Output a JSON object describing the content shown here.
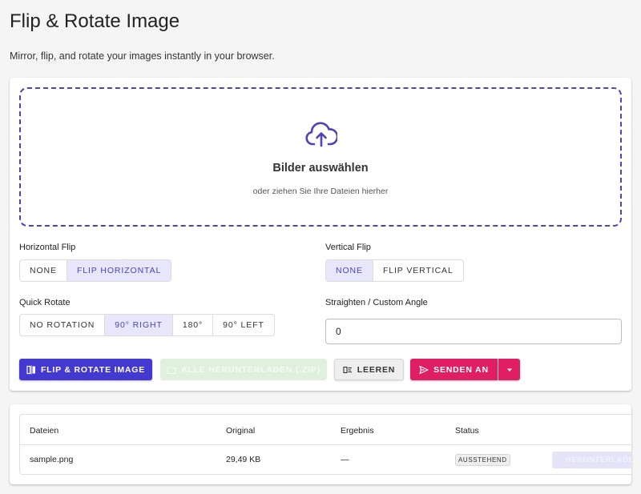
{
  "page": {
    "title": "Flip & Rotate Image",
    "subtitle": "Mirror, flip, and rotate your images instantly in your browser."
  },
  "dropzone": {
    "icon": "cloud-upload-icon",
    "title": "Bilder auswählen",
    "subtitle": "oder ziehen Sie Ihre Dateien hierher"
  },
  "horizontal_flip": {
    "label": "Horizontal Flip",
    "options": [
      "NONE",
      "FLIP HORIZONTAL"
    ],
    "selected": "FLIP HORIZONTAL"
  },
  "vertical_flip": {
    "label": "Vertical Flip",
    "options": [
      "NONE",
      "FLIP VERTICAL"
    ],
    "selected": "NONE"
  },
  "quick_rotate": {
    "label": "Quick Rotate",
    "options": [
      "NO ROTATION",
      "90° RIGHT",
      "180°",
      "90° LEFT"
    ],
    "selected": "90° RIGHT"
  },
  "custom_angle": {
    "label": "Straighten / Custom Angle",
    "value": "0"
  },
  "actions": {
    "process_label": "FLIP & ROTATE IMAGE",
    "download_all_label": "ALLE HERUNTERLADEN (.ZIP)",
    "clear_label": "LEEREN",
    "send_label": "SENDEN AN"
  },
  "colors": {
    "accent": "#4338d0",
    "send": "#e01e63",
    "dropzone_border": "#4c44b8"
  },
  "files_table": {
    "headers": [
      "Dateien",
      "Original",
      "Ergebnis",
      "Status"
    ],
    "rows": [
      {
        "name": "sample.png",
        "original": "29,49 KB",
        "result": "—",
        "status": "AUSSTEHEND",
        "download_label": "HERUNTERLADEN"
      }
    ]
  }
}
